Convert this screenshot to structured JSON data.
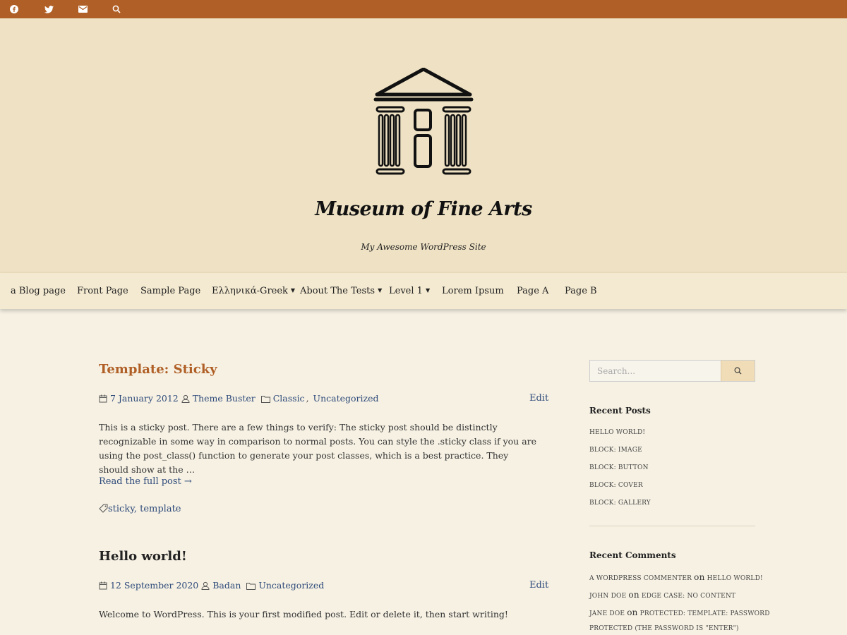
{
  "topbar": {
    "color": "#b05f26",
    "icons": [
      "facebook-icon",
      "twitter-icon",
      "mail-icon",
      "search-icon"
    ]
  },
  "header": {
    "logo_icon": "museum-building-icon",
    "title": "Museum of Fine Arts",
    "tagline": "My Awesome WordPress Site"
  },
  "nav": {
    "items": [
      {
        "label": "a Blog page",
        "dropdown": false
      },
      {
        "label": "Front Page",
        "dropdown": false
      },
      {
        "label": "Sample Page",
        "dropdown": false
      },
      {
        "label": "Ελληνικά-Greek",
        "dropdown": true
      },
      {
        "label": "About The Tests",
        "dropdown": true
      },
      {
        "label": "Level 1",
        "dropdown": true
      },
      {
        "label": "Lorem Ipsum",
        "dropdown": false
      },
      {
        "label": "Page A",
        "dropdown": false
      },
      {
        "label": "Page B",
        "dropdown": false
      }
    ]
  },
  "posts": [
    {
      "title": "Template: Sticky",
      "title_color": "#b05f26",
      "date": "7 January 2012",
      "author": "Theme Buster",
      "categories": [
        "Classic",
        "Uncategorized"
      ],
      "edit_label": "Edit",
      "excerpt": "This is a sticky post. There are a few things to verify: The sticky post should be distinctly recognizable in some way in comparison to normal posts. You can style the .sticky class if you are using the post_class() function to generate your post classes, which is a best practice. They should show at the …",
      "read_more": "Read the full post →",
      "tags": [
        "sticky",
        "template"
      ]
    },
    {
      "title": "Hello world!",
      "title_color": "#222222",
      "date": "12 September 2020",
      "author": "Badan",
      "categories": [
        "Uncategorized"
      ],
      "edit_label": "Edit",
      "excerpt": "Welcome to WordPress. This is your first modified post. Edit or delete it, then start writing!"
    }
  ],
  "sidebar": {
    "search_placeholder": "Search...",
    "recent_posts_title": "Recent Posts",
    "recent_posts": [
      "Hello world!",
      "Block: Image",
      "Block: Button",
      "Block: Cover",
      "Block: Gallery"
    ],
    "recent_comments_title": "Recent Comments",
    "recent_comments": [
      {
        "author": "A WordPress Commenter",
        "on": "on",
        "post": "Hello world!"
      },
      {
        "author": "John Doe",
        "on": "on",
        "post": "Edge Case: No Content"
      },
      {
        "author": "Jane Doe",
        "on": "on",
        "post": "Protected: Template: Password"
      },
      {
        "author": "",
        "on": "",
        "post": "Protected (the password is \"enter\")"
      }
    ]
  },
  "colors": {
    "link": "#2e4a7a",
    "header_bg": "#efe2c4",
    "body_bg": "#f6f1e3"
  }
}
